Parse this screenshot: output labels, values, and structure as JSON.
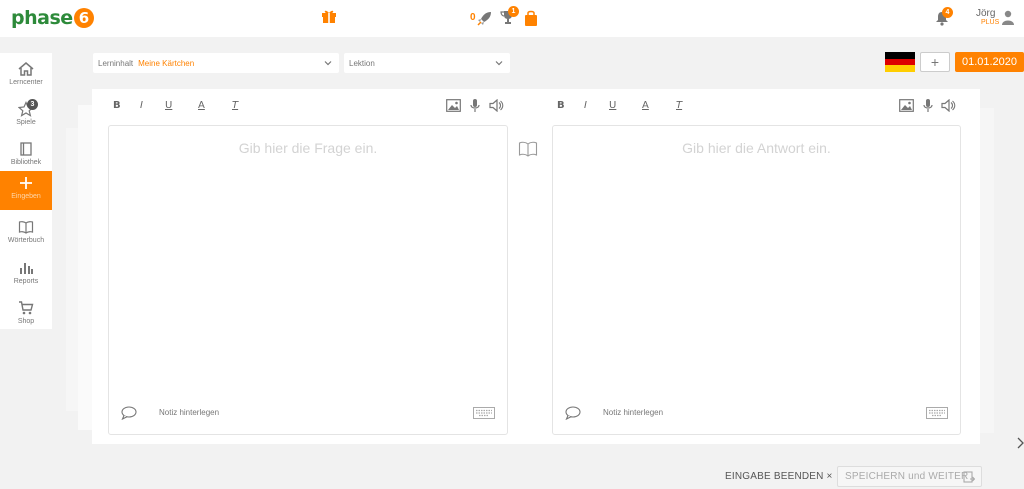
{
  "header": {
    "logo_text": "phase",
    "logo_digit": "6",
    "counter": "0",
    "trophy_badge": "1",
    "notifications_badge": "4",
    "user_name": "Jörg",
    "user_plan": "PLUS"
  },
  "sidebar": {
    "items": [
      {
        "label": "Lerncenter",
        "icon": "home-icon"
      },
      {
        "label": "Spiele",
        "icon": "star-icon",
        "badge": "3"
      },
      {
        "label": "Bibliothek",
        "icon": "book-icon"
      },
      {
        "label": "Eingeben",
        "icon": "plus-icon",
        "active": true
      },
      {
        "label": "Wörterbuch",
        "icon": "dictionary-icon"
      },
      {
        "label": "Reports",
        "icon": "bar-chart-icon"
      },
      {
        "label": "Shop",
        "icon": "cart-icon"
      }
    ]
  },
  "selectors": {
    "content_label": "Lerninhalt",
    "content_value": "Meine Kärtchen",
    "lesson_placeholder": "Lektion"
  },
  "language": {
    "flag": "germany",
    "add_label": "+",
    "date": "01.01.2020"
  },
  "toolbar": {
    "bold": "B",
    "italic": "I",
    "underline": "U",
    "color": "A",
    "clear": "T"
  },
  "question": {
    "placeholder": "Gib hier die Frage ein.",
    "note": "Notiz hinterlegen"
  },
  "answer": {
    "placeholder": "Gib hier die Antwort ein.",
    "note": "Notiz hinterlegen"
  },
  "footer": {
    "end_label": "EINGABE BEENDEN ×",
    "save_label": "SPEICHERN und WEITER"
  },
  "colors": {
    "accent": "#ff8200",
    "brand_green": "#2d8a3a"
  }
}
